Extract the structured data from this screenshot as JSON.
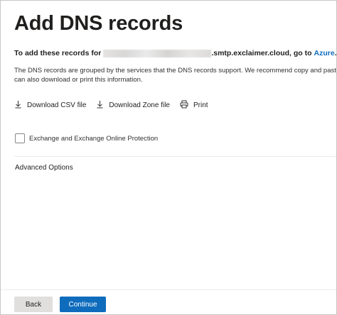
{
  "page": {
    "title": "Add DNS records"
  },
  "instruction": {
    "prefix": "To add these records for",
    "domain_suffix": ".smtp.exclaimer.cloud, go to",
    "link": "Azure",
    "end": "."
  },
  "description": "The DNS records are grouped by the services that the DNS records support. We recommend copy and paste to can also download or print this information.",
  "toolbar": {
    "download_csv": "Download CSV file",
    "download_zone": "Download Zone file",
    "print": "Print"
  },
  "services": [
    {
      "label": "Exchange and Exchange Online Protection",
      "checked": false
    }
  ],
  "advanced_options": "Advanced Options",
  "footer": {
    "back": "Back",
    "continue": "Continue"
  },
  "colors": {
    "primary": "#0f6cbd",
    "secondary_button": "#e1dfdd",
    "text": "#201f1e"
  }
}
